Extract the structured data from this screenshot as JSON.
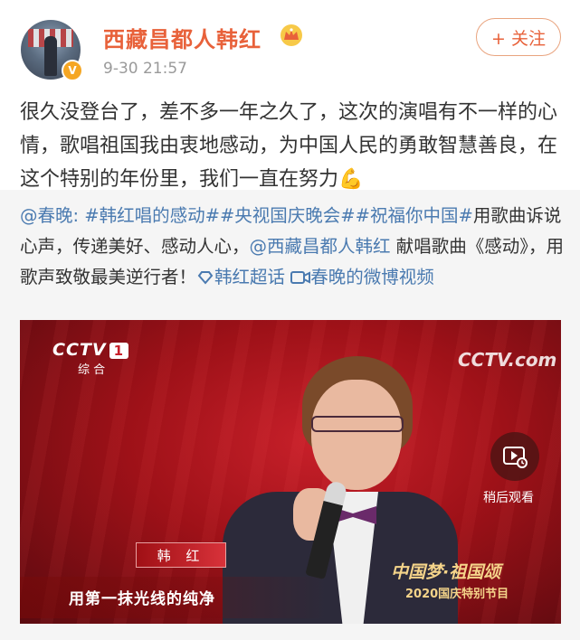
{
  "header": {
    "username": "西藏昌都人韩红",
    "timestamp": "9-30 21:57",
    "follow_label": "+ 关注",
    "verified_badge": "V",
    "icons": [
      "crown-icon",
      "verified-icon"
    ]
  },
  "post": {
    "text": "很久没登台了，差不多一年之久了，这次的演唱有不一样的心情，歌唱祖国我由衷地感动，为中国人民的勇敢智慧善良，在这个特别的年份里，我们一直在努力",
    "emoji": "💪"
  },
  "repost": {
    "mention_chunwan": "@春晚:",
    "tag_1": "#韩红唱的感动#",
    "tag_2": "#央视国庆晚会#",
    "tag_3": "#祝福你中国#",
    "text_1": "用歌曲诉说心声，传递美好、感动人心，",
    "mention_hanhong": "@西藏昌都人韩红",
    "text_2": " 献唱歌曲《感动》，用歌声致敬最美逆行者！",
    "link_topic": "韩红超话",
    "link_video": "春晚的微博视频"
  },
  "video": {
    "channel_logo": "CCTV",
    "channel_number": "1",
    "channel_sub": "综 合",
    "hd_logo": "CCTV.com",
    "name_tag": "韩 红",
    "lyric": "用第一抹光线的纯净",
    "program_title": "中国梦·祖国颂",
    "program_sub": "2020国庆特别节目",
    "watch_later_label": "稍后观看"
  },
  "colors": {
    "username": "#e8613a",
    "link": "#4a7ab0",
    "repost_bg": "#f5f5f5",
    "timestamp": "#9a9a9a"
  }
}
